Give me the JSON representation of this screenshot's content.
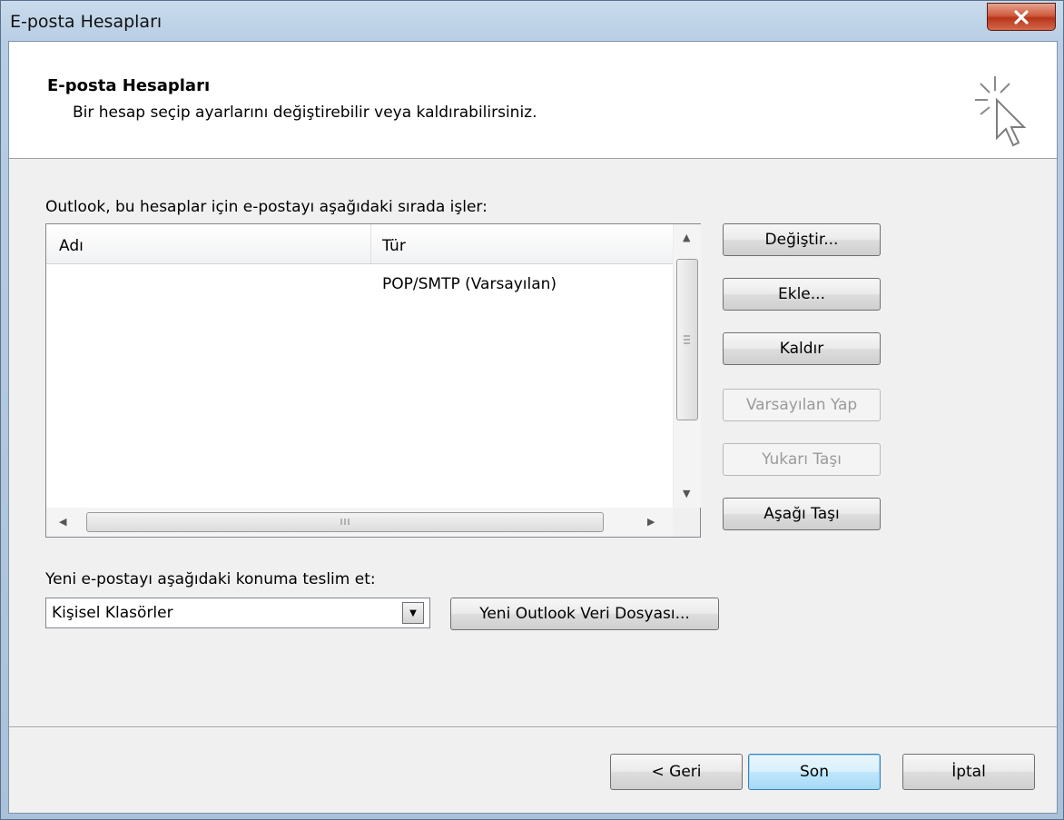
{
  "window": {
    "title": "E-posta Hesapları",
    "close_symbol": "✕"
  },
  "header": {
    "title": "E-posta Hesapları",
    "subtitle": "Bir hesap seçip ayarlarını değiştirebilir veya kaldırabilirsiniz.",
    "icon": "wizard-cursor-icon"
  },
  "accounts": {
    "label": "Outlook, bu hesaplar için e-postayı aşağıdaki sırada işler:",
    "columns": [
      "Adı",
      "Tür"
    ],
    "rows": [
      {
        "name": "",
        "type": "POP/SMTP (Varsayılan)"
      }
    ]
  },
  "side_buttons": {
    "change": "Değiştir...",
    "add": "Ekle...",
    "remove": "Kaldır",
    "set_default": "Varsayılan Yap",
    "move_up": "Yukarı Taşı",
    "move_down": "Aşağı Taşı"
  },
  "delivery": {
    "label": "Yeni e-postayı aşağıdaki konuma teslim et:",
    "selected": "Kişisel Klasörler",
    "new_file_button": "Yeni Outlook Veri Dosyası..."
  },
  "footer": {
    "back": "< Geri",
    "finish": "Son",
    "cancel": "İptal"
  },
  "colors": {
    "close_button": "#c8452a",
    "default_button_border": "#3c7fb1"
  }
}
